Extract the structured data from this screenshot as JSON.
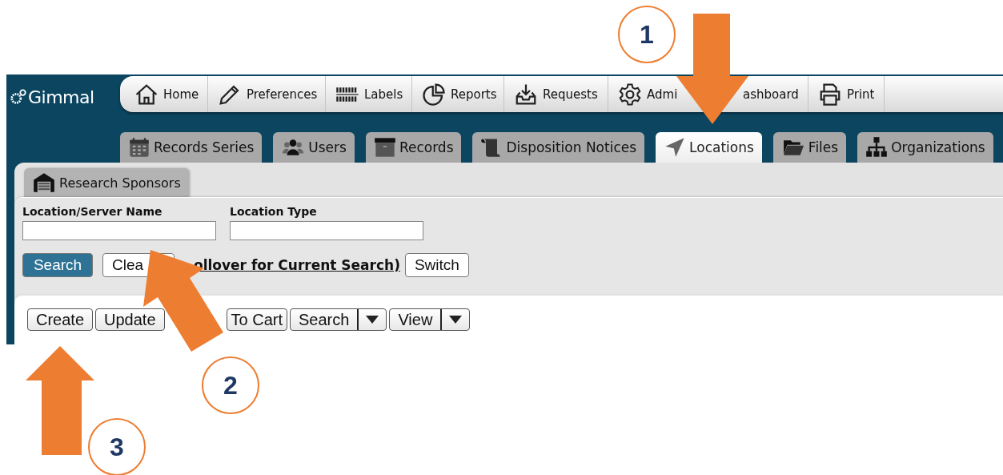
{
  "logo": {
    "text": "Gimmal"
  },
  "top_nav": [
    {
      "label": "Home"
    },
    {
      "label": "Preferences"
    },
    {
      "label": "Labels"
    },
    {
      "label": "Reports"
    },
    {
      "label": "Requests"
    },
    {
      "label": "Admi"
    },
    {
      "label": "ashboard"
    },
    {
      "label": "Print"
    }
  ],
  "tabs": [
    {
      "label": "Records Series",
      "selected": false
    },
    {
      "label": "Users",
      "selected": false
    },
    {
      "label": "Records",
      "selected": false
    },
    {
      "label": "Disposition Notices",
      "selected": false
    },
    {
      "label": "Locations",
      "selected": true
    },
    {
      "label": "Files",
      "selected": false
    },
    {
      "label": "Organizations",
      "selected": false
    }
  ],
  "sub_tab": {
    "label": "Research Sponsors"
  },
  "search_form": {
    "fields": [
      {
        "label": "Location/Server Name"
      },
      {
        "label": "Location Type"
      }
    ],
    "search_button": "Search",
    "clear_button": "Clea",
    "current_search_link": "ollover for Current Search)",
    "switch_button": "Switch"
  },
  "toolbar": [
    {
      "label": "Create",
      "kind": "button"
    },
    {
      "label": "Update",
      "kind": "button"
    },
    {
      "label": "To Cart",
      "kind": "button"
    },
    {
      "label": "Search",
      "kind": "split"
    },
    {
      "label": "View",
      "kind": "split"
    }
  ],
  "annotations": [
    {
      "number": "1"
    },
    {
      "number": "2"
    },
    {
      "number": "3"
    }
  ]
}
